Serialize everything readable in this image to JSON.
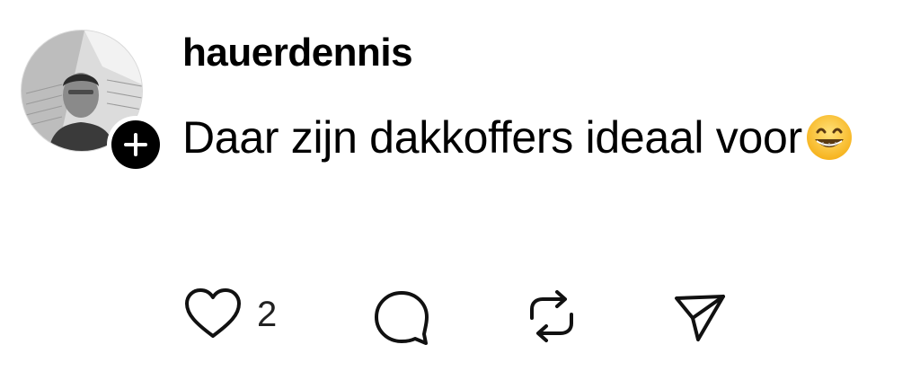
{
  "post": {
    "username": "hauerdennis",
    "text": "Daar zijn dakkoffers ideaal voor",
    "emoji": "grinning-face-with-smiling-eyes"
  },
  "avatar": {
    "badge_icon": "plus-icon"
  },
  "actions": {
    "like_count": "2",
    "icons": [
      "heart-icon",
      "comment-icon",
      "repost-icon",
      "send-icon"
    ]
  }
}
